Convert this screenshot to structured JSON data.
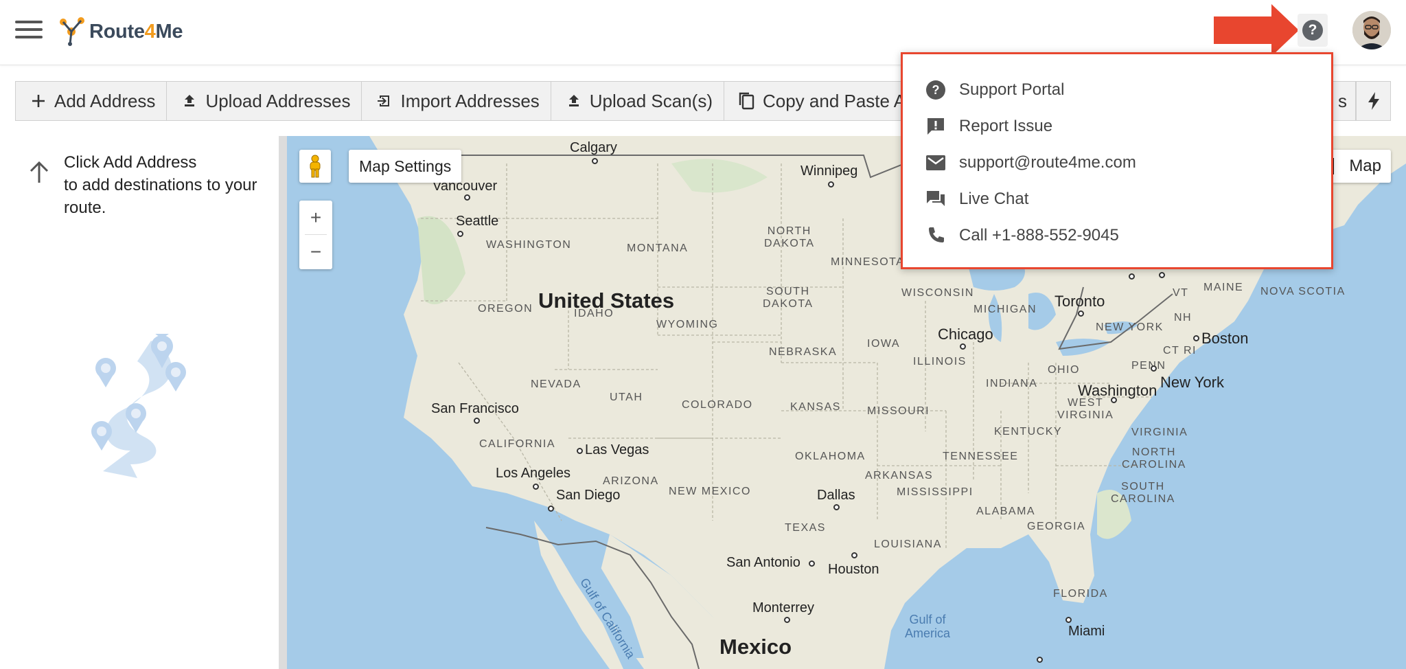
{
  "header": {
    "logo_text_a": "Route",
    "logo_text_b": "4",
    "logo_text_c": "Me",
    "help_icon": "?"
  },
  "toolbar": {
    "buttons": [
      {
        "label": "Add Address",
        "icon": "plus-icon"
      },
      {
        "label": "Upload Addresses",
        "icon": "upload-icon"
      },
      {
        "label": "Import Addresses",
        "icon": "import-icon"
      },
      {
        "label": "Upload Scan(s)",
        "icon": "upload-icon"
      },
      {
        "label": "Copy and Paste Add",
        "icon": "copy-icon"
      }
    ],
    "partial_right_label": "s",
    "quick_icon": "lightning-icon"
  },
  "left_panel": {
    "hint_lines": [
      "Click Add Address",
      "to add destinations to your",
      "route."
    ]
  },
  "map": {
    "settings_label": "Map Settings",
    "zoom_in": "+",
    "zoom_out": "−",
    "type_label": "Map",
    "country_label": "United States",
    "country_label_2": "Mexico",
    "states": [
      "WASHINGTON",
      "MONTANA",
      "NORTH\nDAKOTA",
      "MINNESOTA",
      "OREGON",
      "IDAHO",
      "SOUTH\nDAKOTA",
      "WISCONSIN",
      "MICHIGAN",
      "WYOMING",
      "IOWA",
      "NEBRASKA",
      "NEVADA",
      "UTAH",
      "ILLINOIS",
      "INDIANA",
      "OHIO",
      "PENN",
      "COLORADO",
      "KANSAS",
      "MISSOURI",
      "WEST\nVIRGINIA",
      "VIRGINIA",
      "CALIFORNIA",
      "KENTUCKY",
      "ARIZONA",
      "OKLAHOMA",
      "TENNESSEE",
      "NORTH\nCAROLINA",
      "NEW MEXICO",
      "ARKANSAS",
      "MISSISSIPPI",
      "ALABAMA",
      "SOUTH\nCAROLINA",
      "GEORGIA",
      "TEXAS",
      "LOUISIANA",
      "FLORIDA",
      "NEW YORK",
      "MAINE",
      "NOVA SCOTIA",
      "VT",
      "NH",
      "CT RI"
    ],
    "cities": [
      "Calgary",
      "Winnipeg",
      "Vancouver",
      "Seattle",
      "Toronto",
      "Chicago",
      "Boston",
      "New York",
      "Washington",
      "San Francisco",
      "Las Vegas",
      "Los Angeles",
      "San Diego",
      "Dallas",
      "San Antonio",
      "Houston",
      "Monterrey",
      "Miami"
    ],
    "water": [
      "Gulf of California",
      "Gulf of\nAmerica"
    ]
  },
  "help_menu": {
    "items": [
      {
        "label": "Support Portal",
        "icon": "help-circle-icon"
      },
      {
        "label": "Report Issue",
        "icon": "report-issue-icon"
      },
      {
        "label": "support@route4me.com",
        "icon": "mail-icon"
      },
      {
        "label": "Live Chat",
        "icon": "chat-icon"
      },
      {
        "label": "Call +1-888-552-9045",
        "icon": "phone-icon"
      }
    ]
  },
  "colors": {
    "accent_red": "#e8462f",
    "logo_orange": "#f29c1f",
    "map_water": "#a5cbe8",
    "map_land": "#ebe9dc"
  }
}
